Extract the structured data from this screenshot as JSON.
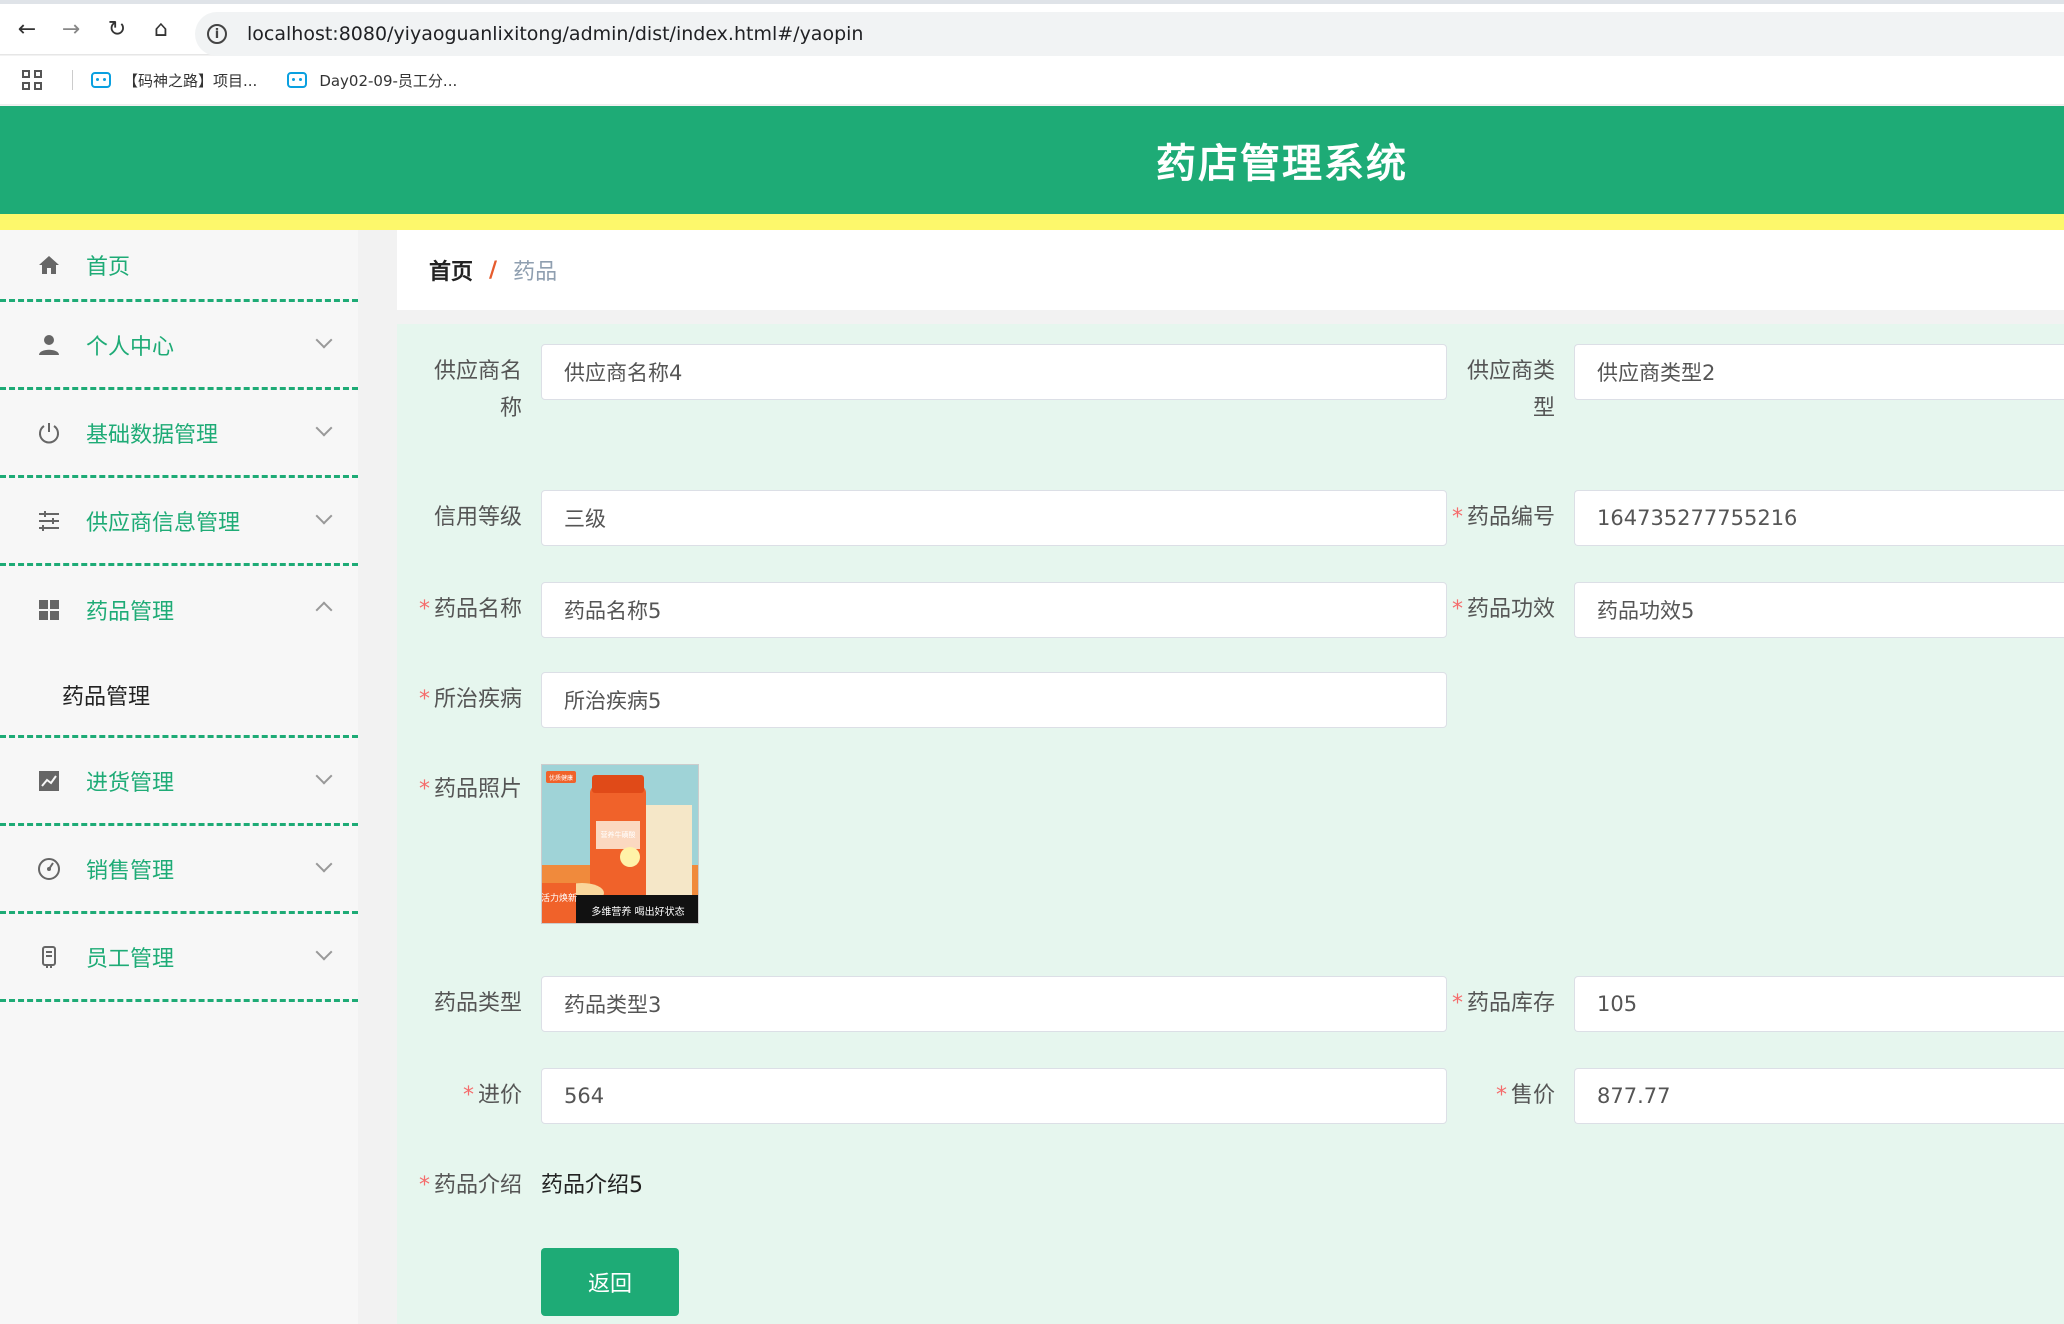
{
  "browser": {
    "url": "localhost:8080/yiyaoguanlixitong/admin/dist/index.html#/yaopin",
    "bookmarks": [
      "【码神之路】项目...",
      "Day02-09-员工分..."
    ]
  },
  "header": {
    "title": "药店管理系统"
  },
  "sidebar": {
    "items": [
      {
        "label": "首页",
        "icon": "home-icon"
      },
      {
        "label": "个人中心",
        "icon": "user-icon"
      },
      {
        "label": "基础数据管理",
        "icon": "power-icon"
      },
      {
        "label": "供应商信息管理",
        "icon": "sliders-icon"
      },
      {
        "label": "药品管理",
        "icon": "grid-icon"
      },
      {
        "label": "进货管理",
        "icon": "chart-icon"
      },
      {
        "label": "销售管理",
        "icon": "gauge-icon"
      },
      {
        "label": "员工管理",
        "icon": "badge-icon"
      }
    ],
    "submenu": "药品管理"
  },
  "breadcrumb": {
    "home": "首页",
    "separator": "/",
    "current": "药品"
  },
  "form": {
    "supplier_name": {
      "label_a": "供应商名",
      "label_b": "称",
      "value": "供应商名称4"
    },
    "supplier_type": {
      "label_a": "供应商类",
      "label_b": "型",
      "value": "供应商类型2"
    },
    "credit_level": {
      "label": "信用等级",
      "value": "三级"
    },
    "drug_code": {
      "label": "药品编号",
      "value": "164735277755216"
    },
    "drug_name": {
      "label": "药品名称",
      "value": "药品名称5"
    },
    "drug_effect": {
      "label": "药品功效",
      "value": "药品功效5"
    },
    "disease": {
      "label": "所治疾病",
      "value": "所治疾病5"
    },
    "photo": {
      "label": "药品照片",
      "texts": {
        "corner": "优质健康",
        "badge": "活力焕新",
        "tagline": "多维营养 喝出好状态",
        "bottle": "营养牛磺酸"
      }
    },
    "drug_type": {
      "label": "药品类型",
      "value": "药品类型3"
    },
    "stock": {
      "label": "药品库存",
      "value": "105"
    },
    "purchase_price": {
      "label": "进价",
      "value": "564"
    },
    "sale_price": {
      "label": "售价",
      "value": "877.77"
    },
    "intro": {
      "label": "药品介绍",
      "value": "药品介绍5"
    },
    "required_mark": "*",
    "back_button": "返回"
  }
}
